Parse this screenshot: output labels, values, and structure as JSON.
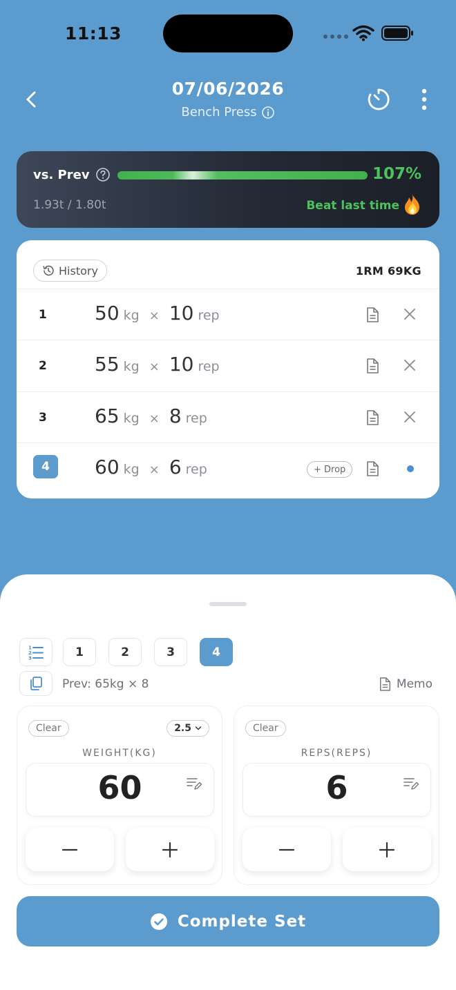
{
  "status_bar": {
    "time": "11:13"
  },
  "header": {
    "date": "07/06/2026",
    "exercise": "Bench Press"
  },
  "progress": {
    "label": "vs. Prev",
    "percent": "107%",
    "percent_value": 107,
    "volume": "1.93t / 1.80t",
    "message": "Beat last time",
    "accent_color": "#4cc35a"
  },
  "sets_card": {
    "history_label": "History",
    "one_rm": "1RM 69KG",
    "sets": [
      {
        "num": "1",
        "weight": "50",
        "weight_unit": "kg",
        "times": "×",
        "reps": "10",
        "reps_unit": "rep"
      },
      {
        "num": "2",
        "weight": "55",
        "weight_unit": "kg",
        "times": "×",
        "reps": "10",
        "reps_unit": "rep"
      },
      {
        "num": "3",
        "weight": "65",
        "weight_unit": "kg",
        "times": "×",
        "reps": "8",
        "reps_unit": "rep"
      },
      {
        "num": "4",
        "weight": "60",
        "weight_unit": "kg",
        "times": "×",
        "reps": "6",
        "reps_unit": "rep",
        "drop_label": "+ Drop"
      }
    ]
  },
  "sheet": {
    "set_chips": [
      "1",
      "2",
      "3",
      "4"
    ],
    "active_chip": "4",
    "prev_text": "Prev: 65kg × 8",
    "memo_label": "Memo",
    "weight_panel": {
      "clear_label": "Clear",
      "step": "2.5",
      "label": "WEIGHT(KG)",
      "value": "60"
    },
    "reps_panel": {
      "clear_label": "Clear",
      "label": "REPS(REPS)",
      "value": "6"
    },
    "complete_label": "Complete Set"
  },
  "icons": {
    "back": "chevron-left-icon",
    "info": "info-icon",
    "timer": "timer-icon",
    "more": "more-vertical-icon",
    "help": "help-icon",
    "flame": "flame-icon",
    "history": "history-icon",
    "note": "note-icon",
    "delete": "close-icon",
    "list": "list-numbered-icon",
    "copy": "copy-icon",
    "edit": "edit-icon",
    "minus": "minus-icon",
    "plus": "plus-icon",
    "check": "check-circle-icon"
  },
  "colors": {
    "background": "#5c9bcd",
    "primary": "#5c9bcd",
    "progress_green": "#4cc35a",
    "dark_card": "#242a36"
  }
}
